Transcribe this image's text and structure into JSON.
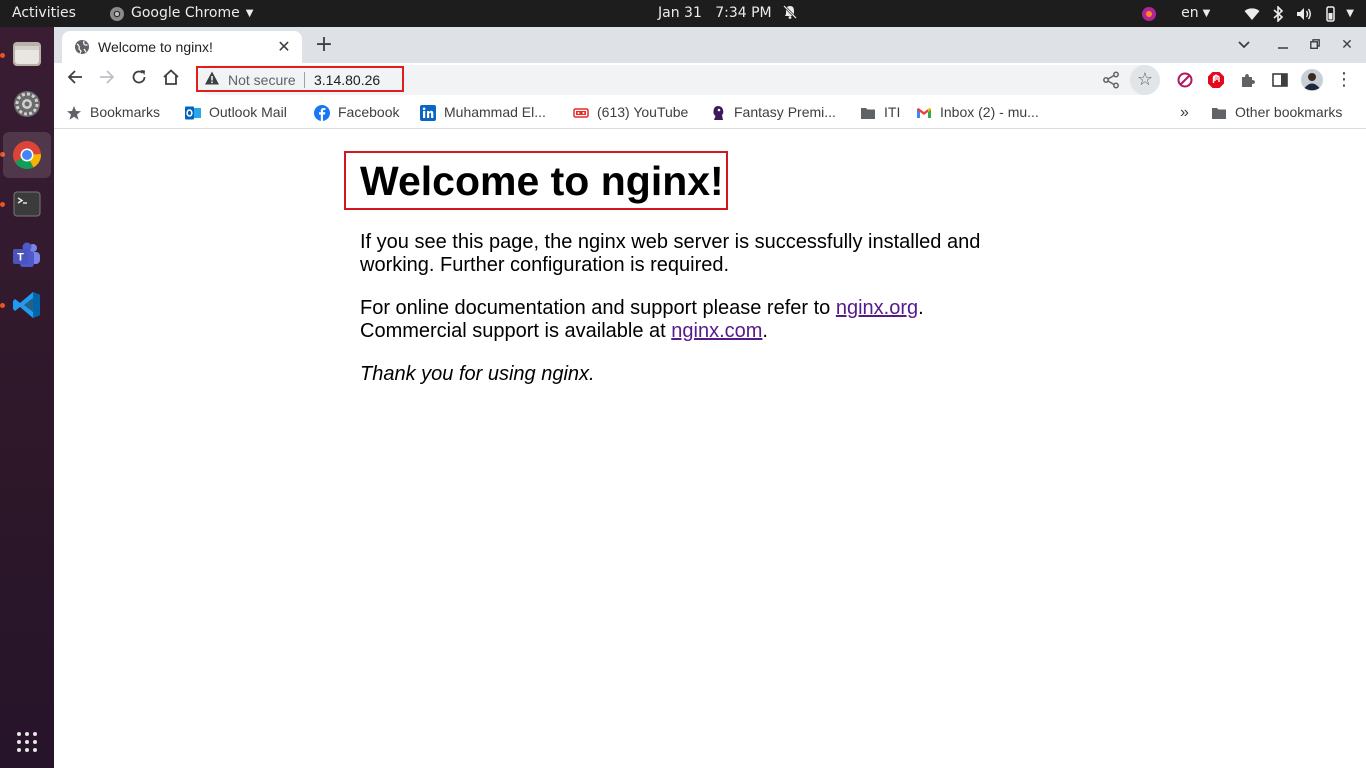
{
  "topbar": {
    "activities": "Activities",
    "app_name": "Google Chrome",
    "date": "Jan 31",
    "time": "7:34 PM",
    "keyboard_lang": "en"
  },
  "dock": {
    "items": [
      "files",
      "settings",
      "google-chrome",
      "terminal",
      "microsoft-teams",
      "visual-studio-code"
    ],
    "show_apps": "show-applications"
  },
  "browser": {
    "tab": {
      "title": "Welcome to nginx!"
    },
    "omnibox": {
      "security_label": "Not secure",
      "url": "3.14.80.26"
    },
    "bookmarks": [
      {
        "label": "Bookmarks",
        "icon": "star-icon"
      },
      {
        "label": "Outlook Mail",
        "icon": "outlook-icon"
      },
      {
        "label": "Facebook",
        "icon": "facebook-icon"
      },
      {
        "label": "Muhammad El...",
        "icon": "linkedin-icon"
      },
      {
        "label": "(613) YouTube",
        "icon": "youtube-icon"
      },
      {
        "label": "Fantasy Premi...",
        "icon": "premier-league-icon"
      },
      {
        "label": "ITI",
        "icon": "folder-icon"
      },
      {
        "label": "Inbox (2) - mu...",
        "icon": "gmail-icon"
      }
    ],
    "overflow": "»",
    "other_bookmarks": "Other bookmarks"
  },
  "page": {
    "heading": "Welcome to nginx!",
    "para1_line1": "If you see this page, the nginx web server is successfully installed and",
    "para1_line2": "working. Further configuration is required.",
    "para2_line1_text": "For online documentation and support please refer to ",
    "para2_link1": "nginx.org",
    "para2_line1_end": ".",
    "para2_line2_text": "Commercial support is available at ",
    "para2_link2": "nginx.com",
    "para2_line2_end": ".",
    "thanks": "Thank you for using nginx."
  },
  "colors": {
    "annotation_red": "#d4171c",
    "link": "#551a8b",
    "ubuntu_orange": "#e95420"
  }
}
